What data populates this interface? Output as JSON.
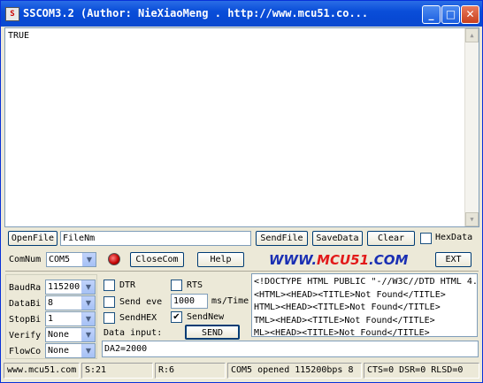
{
  "window": {
    "title": "SSCOM3.2 (Author: NieXiaoMeng .  http://www.mcu51.co...",
    "minimize_glyph": "_",
    "maximize_glyph": "□",
    "close_glyph": "✕"
  },
  "output": {
    "text": "TRUE"
  },
  "toolbar1": {
    "open_file": "OpenFile",
    "file_name": "FileNm",
    "send_file": "SendFile",
    "save_data": "SaveData",
    "clear": "Clear",
    "hex_data": "HexData"
  },
  "toolbar2": {
    "com_num_label": "ComNum",
    "com_port": "COM5",
    "close_com": "CloseCom",
    "help": "Help",
    "logo_pre": "WWW.",
    "logo_mid": "MCU51",
    "logo_post": ".COM",
    "ext": "EXT"
  },
  "settings": {
    "baud_label": "BaudRa",
    "baud_value": "115200",
    "databits_label": "DataBi",
    "databits_value": "8",
    "stopbits_label": "StopBi",
    "stopbits_value": "1",
    "verify_label": "Verify",
    "verify_value": "None",
    "flow_label": "FlowCo",
    "flow_value": "None"
  },
  "options": {
    "dtr": "DTR",
    "rts": "RTS",
    "send_every": "Send eve",
    "interval": "1000",
    "ms_time": "ms/Time",
    "send_hex": "SendHEX",
    "send_new": "SendNew",
    "send_new_checked": true,
    "data_input_label": "Data input:",
    "send_button": "SEND"
  },
  "data_input": {
    "value": "DA2=2000"
  },
  "received": {
    "lines": [
      "<!DOCTYPE HTML PUBLIC \"-//W3C//DTD HTML 4.",
      "<HTML><HEAD><TITLE>Not Found</TITLE>",
      "HTML><HEAD><TITLE>Not Found</TITLE>",
      "TML><HEAD><TITLE>Not Found</TITLE>",
      "ML><HEAD><TITLE>Not Found</TITLE>"
    ]
  },
  "statusbar": {
    "site": "www.mcu51.com",
    "sent": "S:21",
    "received": "R:6",
    "port_status": "COM5 opened 115200bps  8",
    "lines": "CTS=0 DSR=0 RLSD=0"
  },
  "colors": {
    "title_blue": "#0a4ed9",
    "logo_blue": "#1a2fb3",
    "logo_red": "#e21a1a"
  }
}
